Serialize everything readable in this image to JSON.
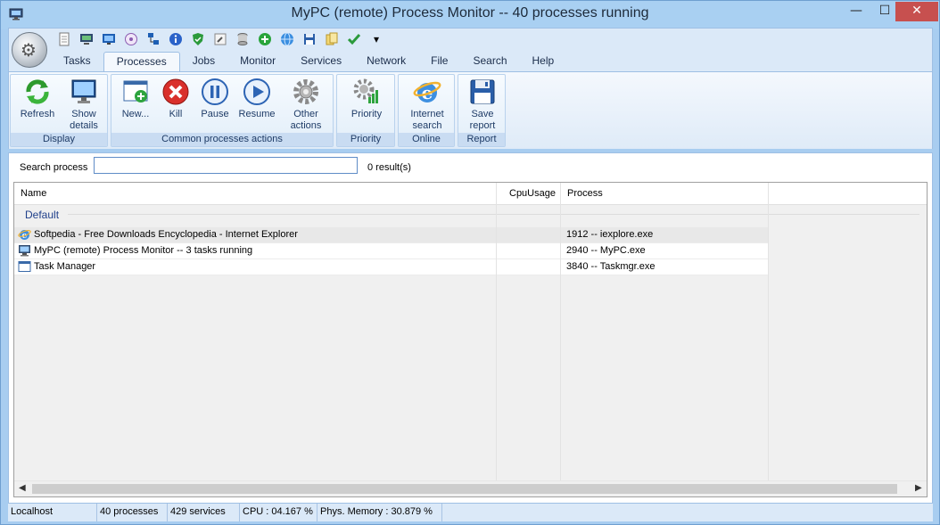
{
  "window": {
    "title": "MyPC (remote) Process Monitor -- 40 processes running",
    "min_label": "—",
    "max_label": "☐",
    "close_label": "✕"
  },
  "qat": {
    "icons": [
      "document-icon",
      "computer-icon",
      "monitor-icon",
      "disc-icon",
      "network-icon",
      "info-icon",
      "shield-icon",
      "wrench-icon",
      "database-icon",
      "add-icon",
      "globe-icon",
      "save-icon",
      "folders-icon",
      "checkmark-icon"
    ],
    "dropdown_label": "▾"
  },
  "tabs": [
    "Tasks",
    "Processes",
    "Jobs",
    "Monitor",
    "Services",
    "Network",
    "File",
    "Search",
    "Help"
  ],
  "active_tab": "Processes",
  "ribbon": {
    "groups": {
      "display": "Display",
      "common": "Common processes actions",
      "priority": "Priority",
      "online": "Online",
      "report": "Report"
    },
    "buttons": {
      "refresh": "Refresh",
      "show_details_1": "Show",
      "show_details_2": "details",
      "new": "New...",
      "kill": "Kill",
      "pause": "Pause",
      "resume": "Resume",
      "other_1": "Other",
      "other_2": "actions",
      "priority": "Priority",
      "search_1": "Internet",
      "search_2": "search",
      "save_1": "Save",
      "save_2": "report"
    }
  },
  "search": {
    "label": "Search process",
    "value": "",
    "result_count": "0 result(s)"
  },
  "table": {
    "columns": [
      "Name",
      "CpuUsage",
      "Process"
    ],
    "group": "Default",
    "rows": [
      {
        "name": "Softpedia - Free Downloads Encyclopedia - Internet Explorer",
        "cpu": "",
        "process": "1912 -- iexplore.exe",
        "icon": "internet-explorer-icon"
      },
      {
        "name": "MyPC (remote) Process Monitor -- 3 tasks running",
        "cpu": "",
        "process": "2940 -- MyPC.exe",
        "icon": "computer-icon"
      },
      {
        "name": "Task Manager",
        "cpu": "",
        "process": "3840 -- Taskmgr.exe",
        "icon": "window-icon"
      }
    ]
  },
  "status": {
    "host": "Localhost",
    "processes": "40 processes",
    "services": "429 services",
    "cpu": "CPU : 04.167 %",
    "memory": "Phys. Memory : 30.879 %"
  },
  "colors": {
    "accent": "#a9d0f2",
    "close": "#c7504f",
    "group_text": "#1f3f8a"
  }
}
